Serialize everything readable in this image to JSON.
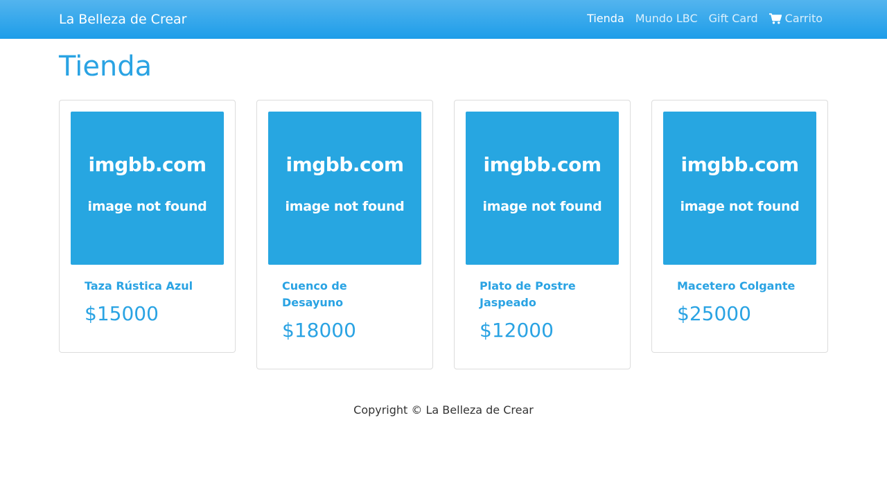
{
  "navbar": {
    "brand": "La Belleza de Crear",
    "links": [
      {
        "label": "Tienda",
        "active": true
      },
      {
        "label": "Mundo LBC",
        "active": false
      },
      {
        "label": "Gift Card",
        "active": false
      },
      {
        "label": "Carrito",
        "icon": "shopping-cart-icon",
        "active": false
      }
    ]
  },
  "main": {
    "title": "Tienda",
    "products": [
      {
        "name": "Taza Rústica Azul",
        "price": "$15000",
        "image_text": {
          "line1": "imgbb.com",
          "line2": "image not found"
        }
      },
      {
        "name": "Cuenco de Desayuno",
        "price": "$18000",
        "image_text": {
          "line1": "imgbb.com",
          "line2": "image not found"
        }
      },
      {
        "name": "Plato de Postre Jaspeado",
        "price": "$12000",
        "image_text": {
          "line1": "imgbb.com",
          "line2": "image not found"
        }
      },
      {
        "name": "Macetero Colgante",
        "price": "$25000",
        "image_text": {
          "line1": "imgbb.com",
          "line2": "image not found"
        }
      }
    ]
  },
  "footer": {
    "copyright": "Copyright © La Belleza de Crear"
  },
  "colors": {
    "accent": "#2aa3e3",
    "navbar_top": "#53b4ee",
    "navbar_bottom": "#1d9de9",
    "image_placeholder": "#27a6e1"
  }
}
